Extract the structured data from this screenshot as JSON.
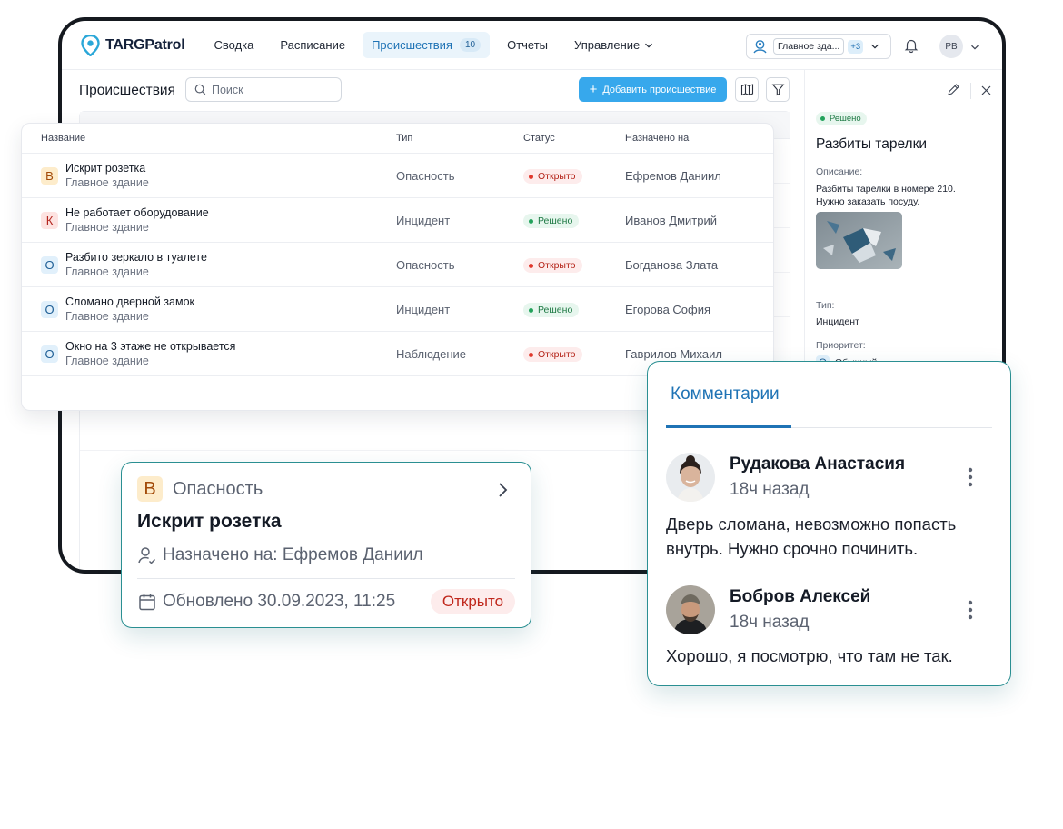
{
  "app": {
    "brand": "TARGPatrol"
  },
  "nav": {
    "items": [
      {
        "label": "Сводка"
      },
      {
        "label": "Расписание"
      },
      {
        "label": "Происшествия",
        "badge": "10",
        "active": true
      },
      {
        "label": "Отчеты"
      },
      {
        "label": "Управление"
      }
    ]
  },
  "location": {
    "selected": "Главное зда...",
    "more": "+3"
  },
  "user": {
    "initials": "РВ"
  },
  "page": {
    "title": "Происшествия",
    "search_placeholder": "Поиск",
    "add_button": "Добавить происшествие"
  },
  "table": {
    "columns": {
      "name": "Название",
      "type": "Тип",
      "status": "Статус",
      "assignee": "Назначено на"
    },
    "rows": [
      {
        "priority": "В",
        "title": "Искрит розетка",
        "building": "Главное здание",
        "type": "Опасность",
        "status": "Открыто",
        "assignee": "Ефремов Даниил"
      },
      {
        "priority": "К",
        "title": "Не работает оборудование",
        "building": "Главное здание",
        "type": "Инцидент",
        "status": "Решено",
        "assignee": "Иванов Дмитрий"
      },
      {
        "priority": "О",
        "title": "Разбито зеркало в туалете",
        "building": "Главное здание",
        "type": "Опасность",
        "status": "Открыто",
        "assignee": "Богданова Злата"
      },
      {
        "priority": "О",
        "title": "Сломано дверной замок",
        "building": "Главное здание",
        "type": "Инцидент",
        "status": "Решено",
        "assignee": "Егорова София"
      },
      {
        "priority": "О",
        "title": "Окно на 3 этаже не открывается",
        "building": "Главное здание",
        "type": "Наблюдение",
        "status": "Открыто",
        "assignee": "Гаврилов Михаил"
      }
    ]
  },
  "detail": {
    "status": "Решено",
    "title": "Разбиты тарелки",
    "description_label": "Описание:",
    "description_line1": "Разбиты тарелки в номере 210.",
    "description_line2": "Нужно заказать посуду.",
    "type_label": "Тип:",
    "type_value": "Инцидент",
    "priority_label": "Приоритет:",
    "priority_letter": "О",
    "priority_value": "Обычный"
  },
  "incident_card": {
    "priority": "В",
    "type": "Опасность",
    "title": "Искрит розетка",
    "assigned": "Назначено на: Ефремов Даниил",
    "updated": "Обновлено 30.09.2023, 11:25",
    "status": "Открыто"
  },
  "comments": {
    "tab": "Комментарии",
    "items": [
      {
        "author": "Рудакова Анастасия",
        "time": "18ч назад",
        "text": "Дверь сломана, невозможно попасть внутрь. Нужно срочно починить."
      },
      {
        "author": "Бобров Алексей",
        "time": "18ч назад",
        "text": "Хорошо, я посмотрю, что там не так."
      }
    ]
  },
  "colors": {
    "accent": "#1f73b5",
    "button": "#37a8ec",
    "open": "#c0281d",
    "resolved": "#1f7a45",
    "card_border": "#2a8f92"
  }
}
